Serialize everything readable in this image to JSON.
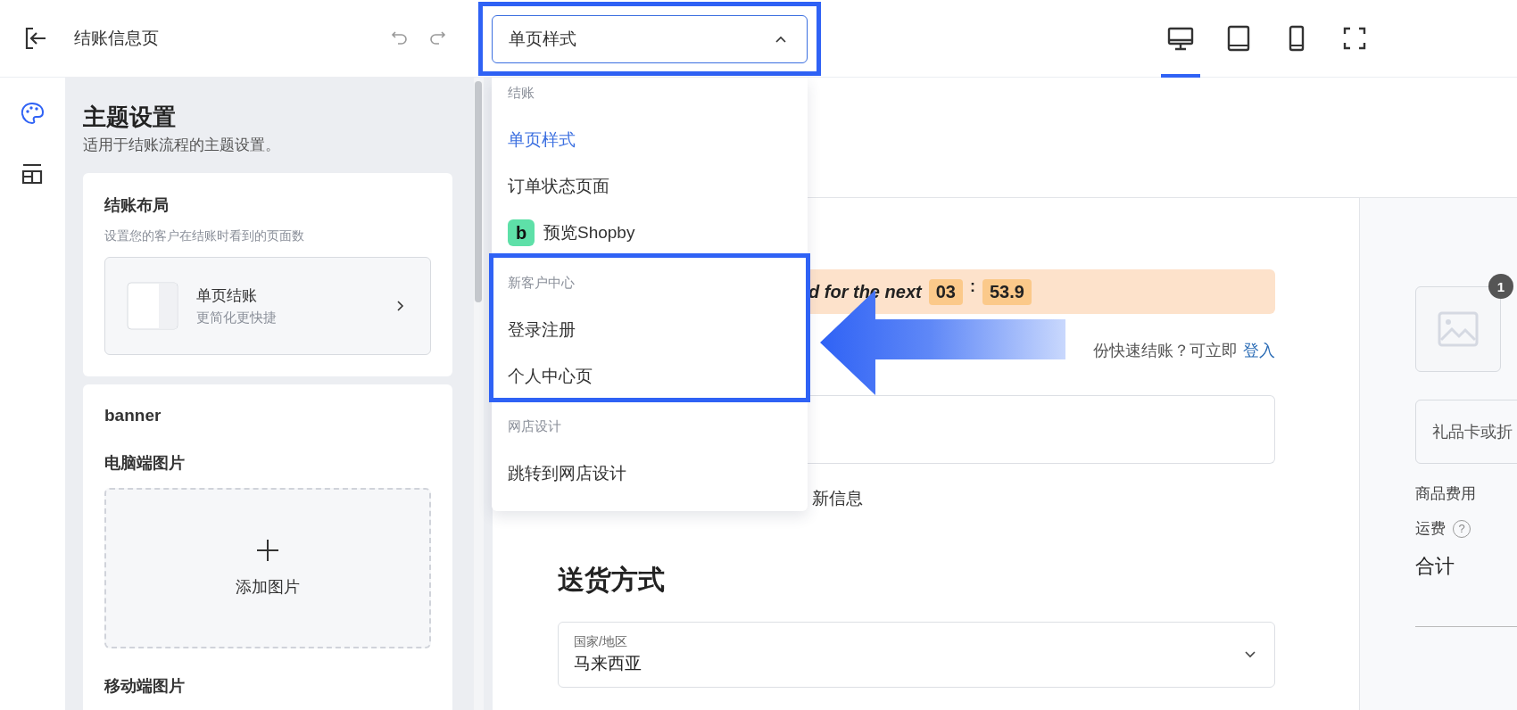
{
  "topbar": {
    "title": "结账信息页",
    "page_select": {
      "value": "单页样式",
      "expanded": true,
      "annotated": true
    },
    "devices": [
      {
        "kind": "desktop",
        "selected": true
      },
      {
        "kind": "tablet",
        "selected": false
      },
      {
        "kind": "phone",
        "selected": false
      },
      {
        "kind": "fullscreen",
        "selected": false
      }
    ]
  },
  "rail": [
    {
      "kind": "palette",
      "selected": true
    },
    {
      "kind": "layout",
      "selected": false
    }
  ],
  "panel": {
    "title": "主题设置",
    "subtitle": "适用于结账流程的主题设置。",
    "layout_card": {
      "title": "结账布局",
      "description": "设置您的客户在结账时看到的页面数",
      "option_title": "单页结账",
      "option_subtitle": "更简化更快捷"
    },
    "banner_card": {
      "title": "banner",
      "desktop_label": "电脑端图片",
      "add_label": "添加图片",
      "mobile_label": "移动端图片"
    }
  },
  "dropdown": {
    "groups": [
      {
        "heading": "结账",
        "annotated": false,
        "items": [
          {
            "label": "单页样式",
            "selected": true
          },
          {
            "label": "订单状态页面",
            "selected": false
          },
          {
            "label": "预览Shopby",
            "selected": false,
            "logo": "b"
          }
        ]
      },
      {
        "heading": "新客户中心",
        "annotated": true,
        "items": [
          {
            "label": "登录注册",
            "selected": false
          },
          {
            "label": "个人中心页",
            "selected": false
          }
        ]
      },
      {
        "heading": "网店设计",
        "annotated": false,
        "items": [
          {
            "label": "跳转到网店设计",
            "selected": false
          }
        ]
      }
    ]
  },
  "preview": {
    "timer": {
      "text": "d for the next",
      "minutes": "03",
      "separator": ":",
      "seconds": "53.9"
    },
    "login_prompt": "份快速结账？可立即",
    "login_link": "登入",
    "update_label": "新信息",
    "shipping_heading": "送货方式",
    "country": {
      "label": "国家/地区",
      "value": "马来西亚"
    },
    "summary": {
      "item_count": "1",
      "gift_placeholder": "礼品卡或折",
      "subtotal_label": "商品费用",
      "shipping_label": "运费",
      "help_glyph": "?",
      "total_label": "合计"
    }
  }
}
